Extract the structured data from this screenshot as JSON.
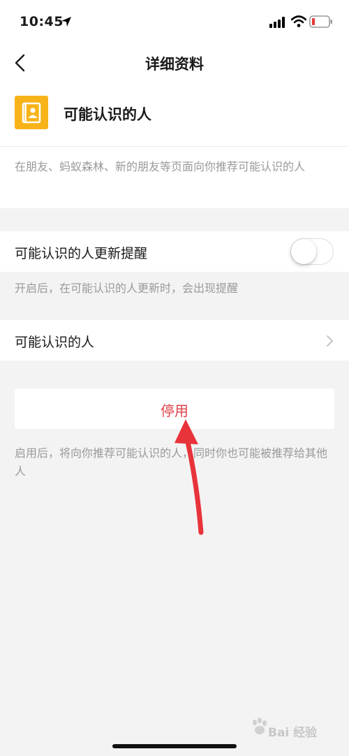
{
  "status_bar": {
    "time": "10:45"
  },
  "nav": {
    "title": "详细资料"
  },
  "header": {
    "name": "可能认识的人",
    "description": "在朋友、蚂蚁森林、新的朋友等页面向你推荐可能认识的人"
  },
  "update_reminder": {
    "label": "可能认识的人更新提醒",
    "enabled": false,
    "hint": "开启后，在可能认识的人更新时，会出现提醒"
  },
  "people_row": {
    "label": "可能认识的人"
  },
  "disable_button": {
    "label": "停用"
  },
  "footer_hint": "启用后，将向你推荐可能认识的人，同时你也可能被推荐给其他人",
  "watermark": {
    "text": "Bai 经验"
  },
  "colors": {
    "accent_red": "#e0414b",
    "icon_yellow": "#f7b318",
    "arrow_red": "#e8333b"
  }
}
